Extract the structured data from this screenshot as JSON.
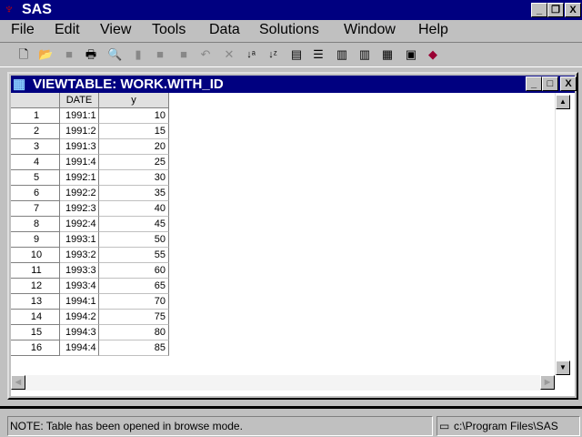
{
  "app_title": "SAS",
  "menu": [
    "File",
    "Edit",
    "View",
    "Tools",
    "Data",
    "Solutions",
    "Window",
    "Help"
  ],
  "window_title": "VIEWTABLE:  WORK.WITH_ID",
  "columns": [
    "DATE",
    "y"
  ],
  "rows": [
    [
      "1",
      "1991:1",
      "10"
    ],
    [
      "2",
      "1991:2",
      "15"
    ],
    [
      "3",
      "1991:3",
      "20"
    ],
    [
      "4",
      "1991:4",
      "25"
    ],
    [
      "5",
      "1992:1",
      "30"
    ],
    [
      "6",
      "1992:2",
      "35"
    ],
    [
      "7",
      "1992:3",
      "40"
    ],
    [
      "8",
      "1992:4",
      "45"
    ],
    [
      "9",
      "1993:1",
      "50"
    ],
    [
      "10",
      "1993:2",
      "55"
    ],
    [
      "11",
      "1993:3",
      "60"
    ],
    [
      "12",
      "1993:4",
      "65"
    ],
    [
      "13",
      "1994:1",
      "70"
    ],
    [
      "14",
      "1994:2",
      "75"
    ],
    [
      "15",
      "1994:3",
      "80"
    ],
    [
      "16",
      "1994:4",
      "85"
    ]
  ],
  "status": {
    "message": "NOTE: Table has been opened in browse mode.",
    "path": "c:\\Program Files\\SAS"
  }
}
